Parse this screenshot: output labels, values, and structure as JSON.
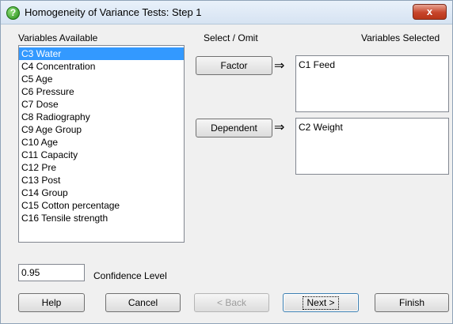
{
  "window": {
    "title": "Homogeneity of Variance Tests: Step 1",
    "close_glyph": "x"
  },
  "labels": {
    "variables_available": "Variables Available",
    "select_omit": "Select / Omit",
    "variables_selected": "Variables Selected",
    "confidence_level": "Confidence Level"
  },
  "available_list": {
    "selected_index": 0,
    "items": [
      "C3 Water",
      "C4 Concentration",
      "C5 Age",
      "C6 Pressure",
      "C7 Dose",
      "C8 Radiography",
      "C9 Age Group",
      "C10 Age",
      "C11 Capacity",
      "C12 Pre",
      "C13 Post",
      "C14 Group",
      "C15 Cotton percentage",
      "C16 Tensile strength"
    ]
  },
  "factor": {
    "button_label": "Factor",
    "arrow": "⇒",
    "items": [
      "C1 Feed"
    ]
  },
  "dependent": {
    "button_label": "Dependent",
    "arrow": "⇒",
    "items": [
      "C2 Weight"
    ]
  },
  "confidence_input": {
    "value": "0.95"
  },
  "footer_buttons": {
    "help": "Help",
    "cancel": "Cancel",
    "back": "< Back",
    "next": "Next >",
    "finish": "Finish"
  },
  "colors": {
    "selection": "#3399ff",
    "dialog_bg": "#f0f0f0"
  }
}
